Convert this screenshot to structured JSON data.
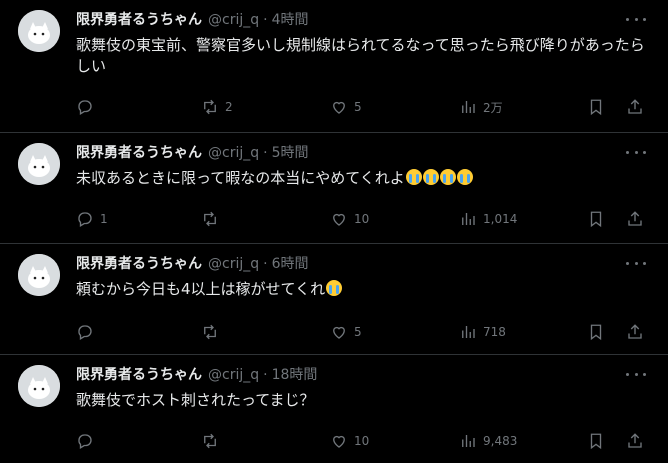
{
  "tweets": [
    {
      "name": "限界勇者るうちゃん",
      "handle": "@crij_q",
      "time": "4時間",
      "text": "歌舞伎の東宝前、警察官多いし規制線はられてるなって思ったら飛び降りがあったらしい",
      "emoji_count": 0,
      "replies": "",
      "retweets": "2",
      "likes": "5",
      "views": "2万"
    },
    {
      "name": "限界勇者るうちゃん",
      "handle": "@crij_q",
      "time": "5時間",
      "text": "未収あるときに限って暇なの本当にやめてくれよ",
      "emoji_count": 4,
      "replies": "1",
      "retweets": "",
      "likes": "10",
      "views": "1,014"
    },
    {
      "name": "限界勇者るうちゃん",
      "handle": "@crij_q",
      "time": "6時間",
      "text": "頼むから今日も4以上は稼がせてくれ",
      "emoji_count": 1,
      "replies": "",
      "retweets": "",
      "likes": "5",
      "views": "718"
    },
    {
      "name": "限界勇者るうちゃん",
      "handle": "@crij_q",
      "time": "18時間",
      "text": "歌舞伎でホスト刺されたってまじ？",
      "emoji_count": 0,
      "replies": "",
      "retweets": "",
      "likes": "10",
      "views": "9,483"
    }
  ],
  "separator": "·",
  "icons": {
    "reply": "reply-icon",
    "retweet": "retweet-icon",
    "like": "heart-icon",
    "views": "views-icon",
    "bookmark": "bookmark-icon",
    "share": "share-icon",
    "more": "more-icon",
    "emoji": "loudly-crying-face-emoji"
  },
  "colors": {
    "background": "#000000",
    "text": "#e7e9ea",
    "muted": "#71767b",
    "border": "#2f3336"
  }
}
